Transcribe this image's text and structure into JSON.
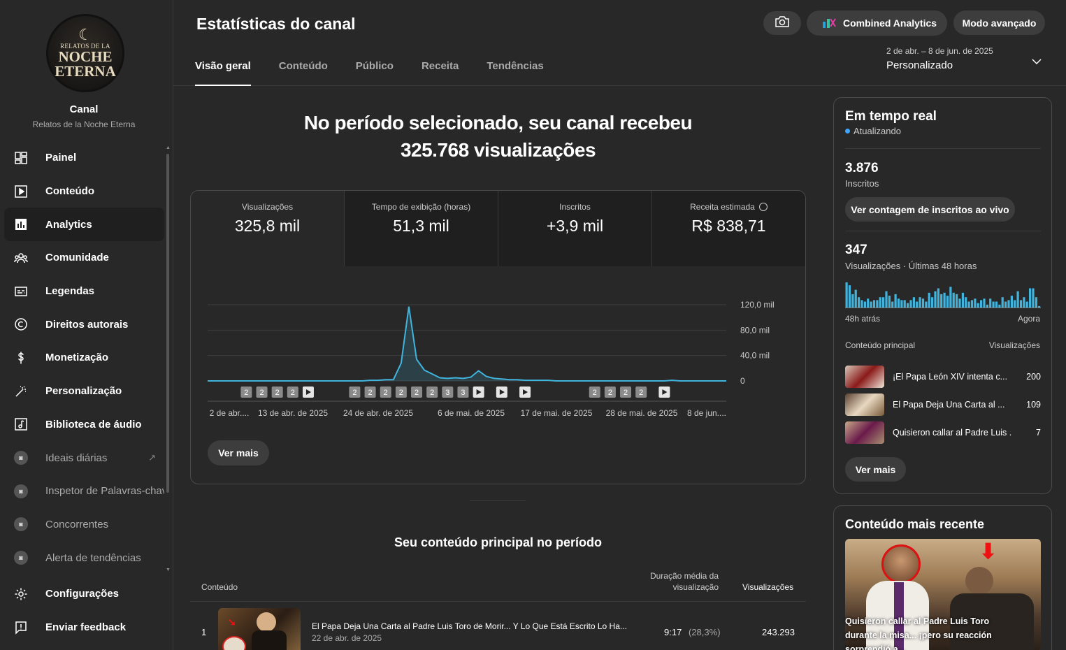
{
  "channel": {
    "logo_text": {
      "line1": "RELATOS DE LA",
      "line2": "NOCHE",
      "line3": "ETERNA"
    },
    "label": "Canal",
    "name": "Relatos de la Noche Eterna"
  },
  "sidebar": {
    "items": [
      {
        "label": "Painel",
        "icon": "dashboard-icon"
      },
      {
        "label": "Conteúdo",
        "icon": "content-icon"
      },
      {
        "label": "Analytics",
        "icon": "analytics-icon",
        "active": true
      },
      {
        "label": "Comunidade",
        "icon": "community-icon"
      },
      {
        "label": "Legendas",
        "icon": "subtitles-icon"
      },
      {
        "label": "Direitos autorais",
        "icon": "copyright-icon"
      },
      {
        "label": "Monetização",
        "icon": "dollar-icon"
      },
      {
        "label": "Personalização",
        "icon": "magic-wand-icon"
      },
      {
        "label": "Biblioteca de áudio",
        "icon": "audio-library-icon"
      },
      {
        "label": "Ideais diárias",
        "icon": "extension-icon"
      },
      {
        "label": "Inspetor de Palavras-chav",
        "icon": "extension-icon"
      },
      {
        "label": "Concorrentes",
        "icon": "extension-icon"
      },
      {
        "label": "Alerta de tendências",
        "icon": "extension-icon"
      }
    ],
    "bottom": [
      {
        "label": "Configurações",
        "icon": "gear-icon"
      },
      {
        "label": "Enviar feedback",
        "icon": "feedback-icon"
      }
    ]
  },
  "header": {
    "title": "Estatísticas do canal",
    "tabs": [
      "Visão geral",
      "Conteúdo",
      "Público",
      "Receita",
      "Tendências"
    ],
    "combined_label": "Combined Analytics",
    "advanced_label": "Modo avançado",
    "date_range": "2 de abr. – 8 de jun. de 2025",
    "date_mode": "Personalizado"
  },
  "summary": {
    "line1": "No período selecionado, seu canal recebeu",
    "line2": "325.768 visualizações"
  },
  "metrics": [
    {
      "label": "Visualizações",
      "value": "325,8 mil"
    },
    {
      "label": "Tempo de exibição (horas)",
      "value": "51,3 mil"
    },
    {
      "label": "Inscritos",
      "value": "+3,9 mil"
    },
    {
      "label": "Receita estimada",
      "value": "R$ 838,71"
    }
  ],
  "chart_data": {
    "type": "line",
    "series": [
      {
        "values": [
          0,
          0,
          0,
          0,
          0,
          0,
          0,
          0,
          0,
          0,
          0,
          0,
          0,
          0,
          0,
          0,
          0,
          0,
          0,
          0,
          0,
          1,
          1,
          2,
          2,
          28,
          117,
          34,
          17,
          11,
          5,
          4,
          5,
          4,
          6,
          16,
          7,
          4,
          3,
          2,
          2,
          1,
          1,
          1,
          1,
          0,
          0,
          0,
          0,
          0,
          0,
          0,
          0,
          0,
          0,
          0,
          0,
          0,
          0,
          0,
          1,
          0,
          0,
          0,
          0,
          0,
          0,
          0
        ]
      }
    ],
    "ylim": [
      0,
      120
    ],
    "yticks": [
      "120,0 mil",
      "80,0 mil",
      "40,0 mil",
      "0"
    ],
    "xticks": [
      "2 de abr....",
      "13 de abr. de 2025",
      "24 de abr. de 2025",
      "6 de mai. de 2025",
      "17 de mai. de 2025",
      "28 de mai. de 2025",
      "8 de jun...."
    ],
    "markers": [
      {
        "day": 5,
        "label": "2"
      },
      {
        "day": 7,
        "label": "2"
      },
      {
        "day": 9,
        "label": "2"
      },
      {
        "day": 11,
        "label": "2"
      },
      {
        "day": 13,
        "label": "play"
      },
      {
        "day": 19,
        "label": "2"
      },
      {
        "day": 21,
        "label": "2"
      },
      {
        "day": 23,
        "label": "2"
      },
      {
        "day": 25,
        "label": "2"
      },
      {
        "day": 27,
        "label": "2"
      },
      {
        "day": 29,
        "label": "2"
      },
      {
        "day": 31,
        "label": "3"
      },
      {
        "day": 33,
        "label": "3"
      },
      {
        "day": 35,
        "label": "play"
      },
      {
        "day": 38,
        "label": "play"
      },
      {
        "day": 41,
        "label": "play"
      },
      {
        "day": 50,
        "label": "2"
      },
      {
        "day": 52,
        "label": "2"
      },
      {
        "day": 54,
        "label": "2"
      },
      {
        "day": 56,
        "label": "2"
      },
      {
        "day": 59,
        "label": "play"
      }
    ]
  },
  "main": {
    "more_label": "Ver mais",
    "top_title": "Seu conteúdo principal no período",
    "col_content": "Conteúdo",
    "col_duration": "Duração média da visualização",
    "col_views": "Visualizações",
    "rows": [
      {
        "rank": "1",
        "title": "El Papa Deja Una Carta al Padre Luis Toro de Morir... Y Lo Que Está Escrito Lo Ha...",
        "date": "22 de abr. de 2025",
        "duration": "9:17",
        "pct": "(28,3%)",
        "views": "243.293"
      }
    ]
  },
  "realtime": {
    "title": "Em tempo real",
    "status": "Atualizando",
    "subs": "3.876",
    "subs_label": "Inscritos",
    "subs_btn": "Ver contagem de inscritos ao vivo",
    "views": "347",
    "views_label": "Visualizações · Últimas 48 horas",
    "bars": [
      34,
      30,
      18,
      24,
      14,
      10,
      8,
      12,
      8,
      10,
      10,
      14,
      14,
      22,
      16,
      8,
      18,
      12,
      10,
      10,
      6,
      10,
      14,
      8,
      14,
      12,
      8,
      20,
      14,
      22,
      26,
      18,
      20,
      16,
      28,
      20,
      18,
      12,
      20,
      14,
      8,
      10,
      12,
      6,
      10,
      12,
      4,
      12,
      8,
      8,
      4,
      14,
      8,
      10,
      16,
      10,
      22,
      10,
      14,
      8,
      26,
      26,
      14,
      2
    ],
    "ago_label": "48h atrás",
    "now_label": "Agora",
    "top_label": "Conteúdo principal",
    "top_views_label": "Visualizações",
    "items": [
      {
        "title": "¡El Papa León XIV intenta c...",
        "views": "200"
      },
      {
        "title": "El Papa Deja Una Carta al ...",
        "views": "109"
      },
      {
        "title": "Quisieron callar al Padre Luis ...",
        "views": "7"
      }
    ],
    "more_label": "Ver mais"
  },
  "recent": {
    "title": "Conteúdo mais recente",
    "caption": "Quisieron callar al Padre Luis Toro durante la misa... ¡pero su reacción sorprendió a..."
  },
  "colors": {
    "background": "#282828",
    "accent": "#3ea6ff",
    "line": "#41b4de"
  }
}
